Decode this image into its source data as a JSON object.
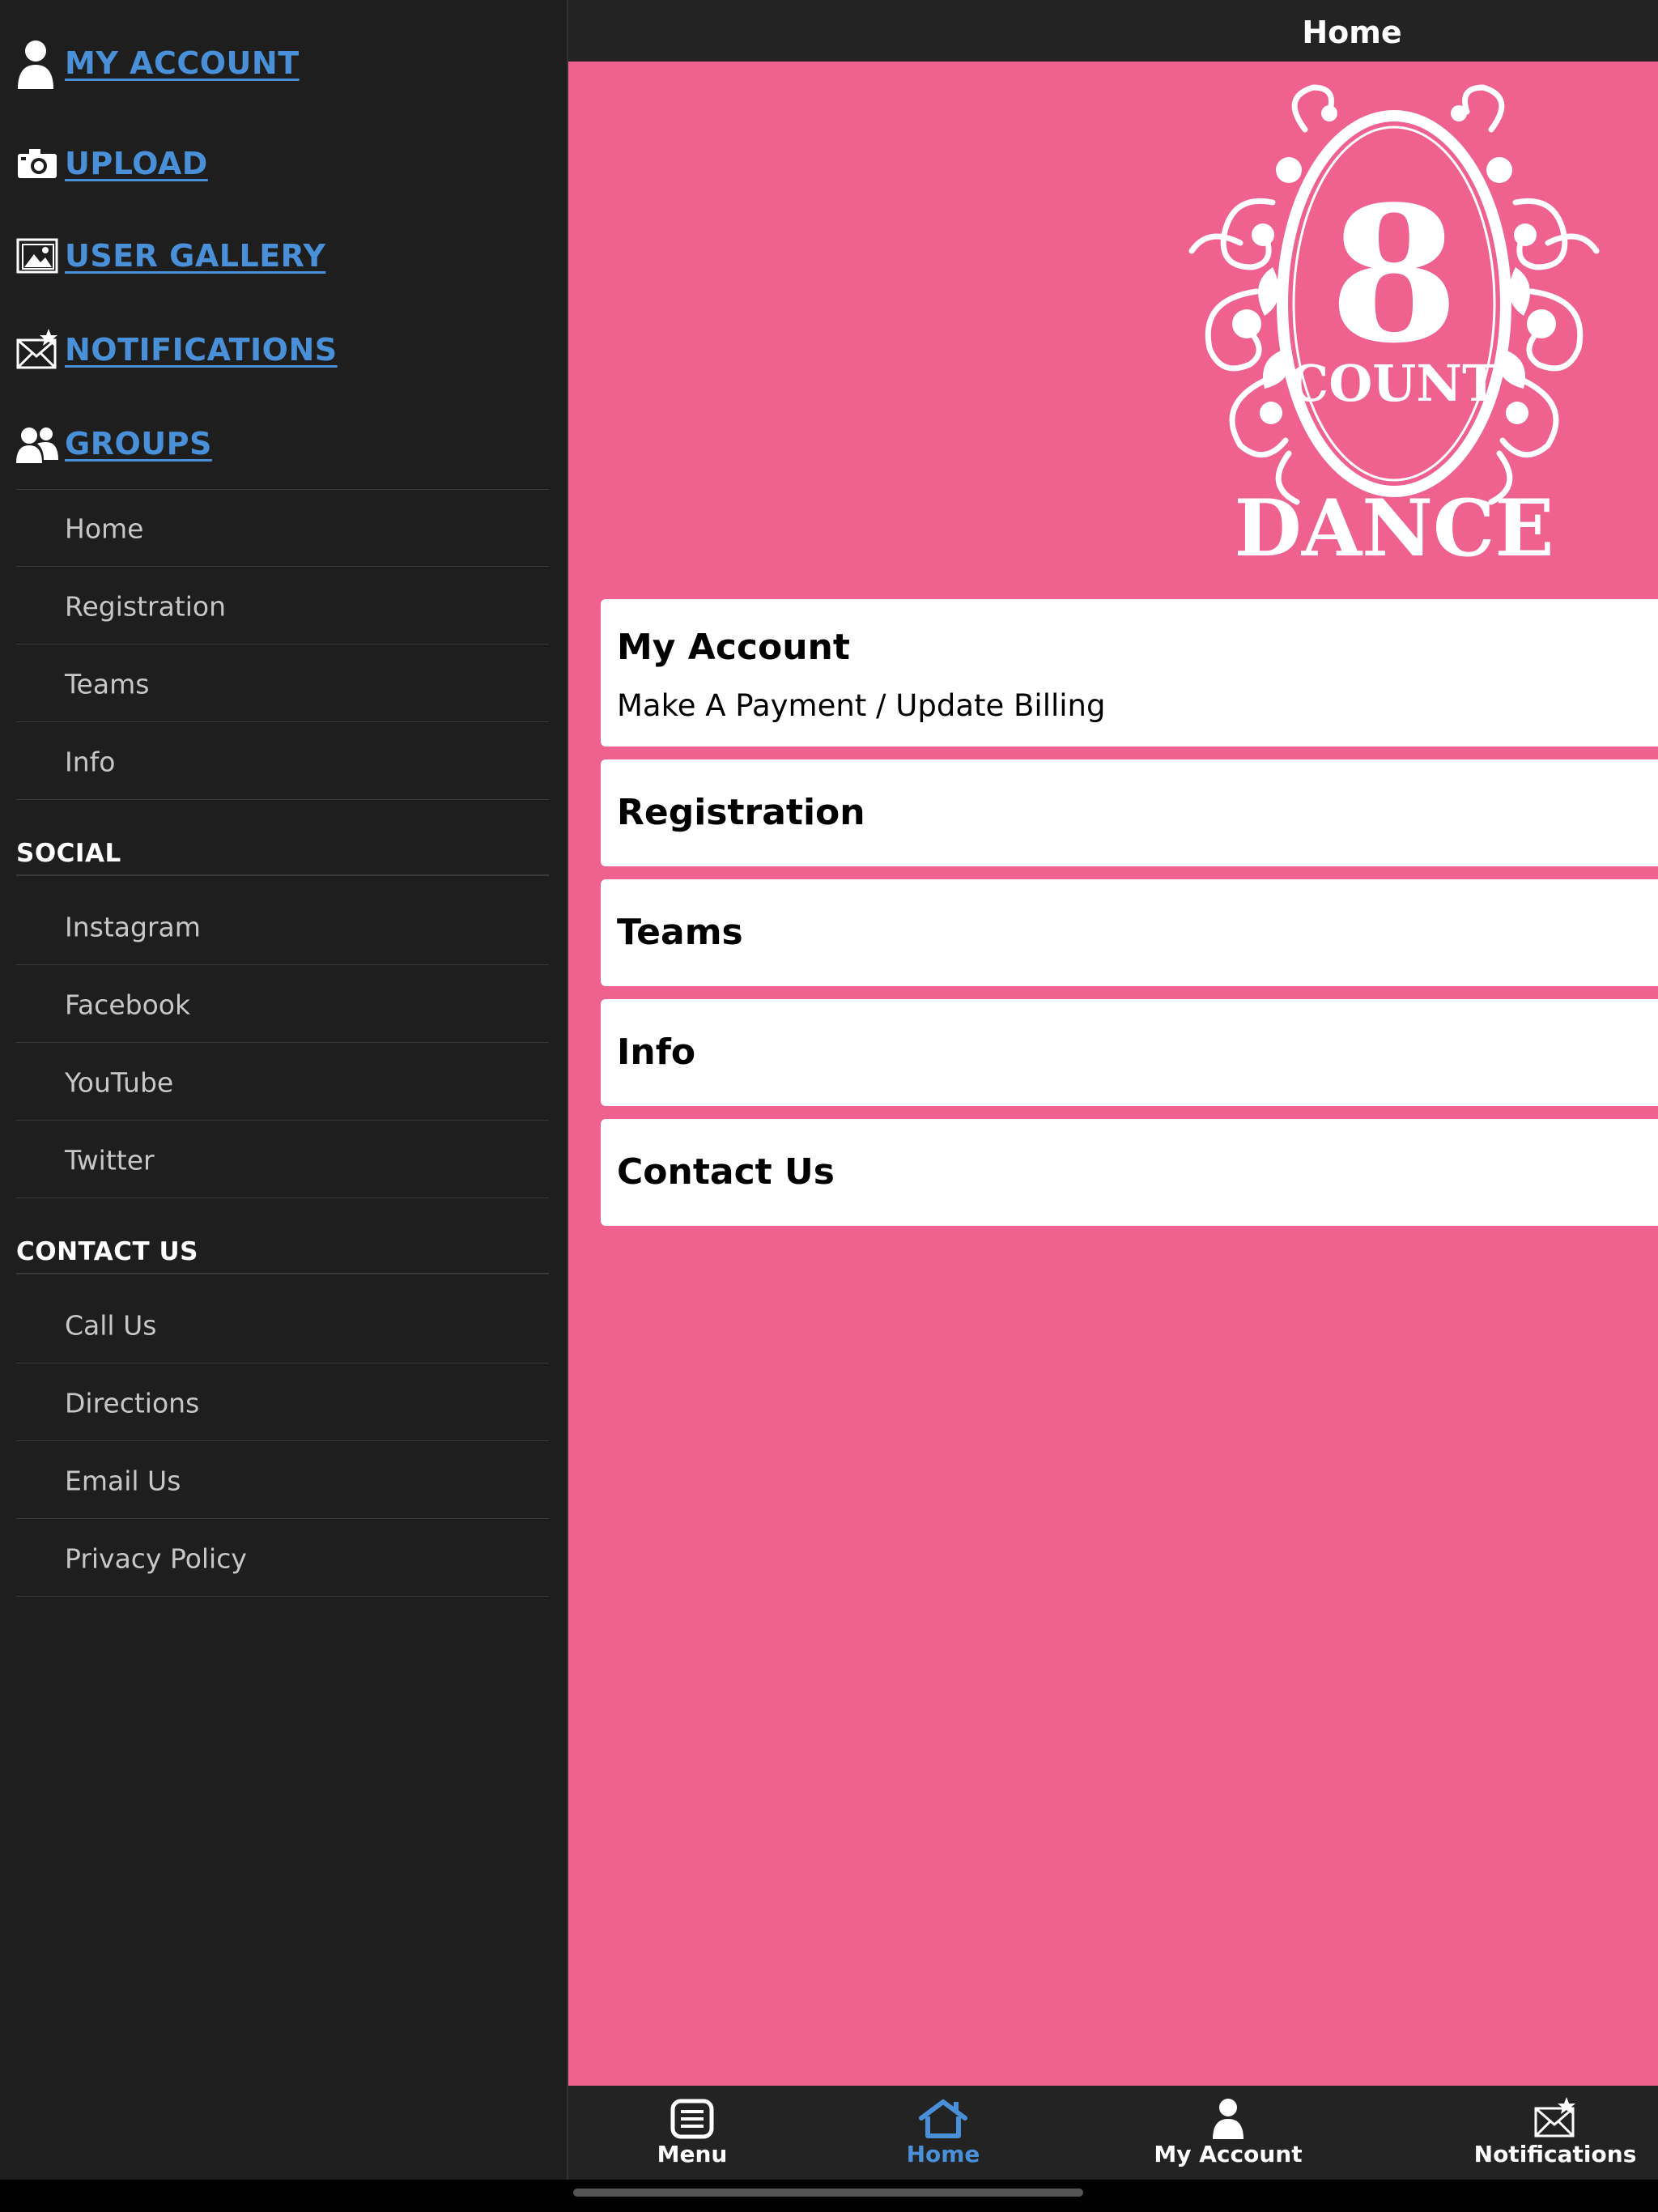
{
  "sidebar": {
    "primary": [
      {
        "label": "MY ACCOUNT",
        "icon": "user-icon"
      },
      {
        "label": "UPLOAD",
        "icon": "camera-icon"
      },
      {
        "label": "USER GALLERY",
        "icon": "gallery-icon"
      },
      {
        "label": "NOTIFICATIONS",
        "icon": "notifications-icon"
      },
      {
        "label": "GROUPS",
        "icon": "groups-icon"
      }
    ],
    "groups_items": [
      "Home",
      "Registration",
      "Teams",
      "Info"
    ],
    "social_heading": "SOCIAL",
    "social_items": [
      "Instagram",
      "Facebook",
      "YouTube",
      "Twitter"
    ],
    "contact_heading": "CONTACT US",
    "contact_items": [
      "Call Us",
      "Directions",
      "Email Us",
      "Privacy Policy"
    ]
  },
  "header": {
    "title": "Home"
  },
  "logo": {
    "top_text": "8",
    "middle_text": "COUNT",
    "bottom_text": "DANCE"
  },
  "cards": [
    {
      "title": "My Account",
      "subtitle": "Make A Payment / Update Billing"
    },
    {
      "title": "Registration"
    },
    {
      "title": "Teams"
    },
    {
      "title": "Info"
    },
    {
      "title": "Contact Us"
    }
  ],
  "tabbar": {
    "items": [
      {
        "label": "Menu",
        "icon": "menu-icon"
      },
      {
        "label": "Home",
        "icon": "home-icon",
        "active": true
      },
      {
        "label": "My Account",
        "icon": "user-icon"
      },
      {
        "label": "Notifications",
        "icon": "notifications-icon"
      }
    ]
  },
  "colors": {
    "accent": "#4a90d9",
    "main_background": "#ef628f",
    "sidebar_background": "#1e1e1e",
    "bar_background": "#232323"
  }
}
